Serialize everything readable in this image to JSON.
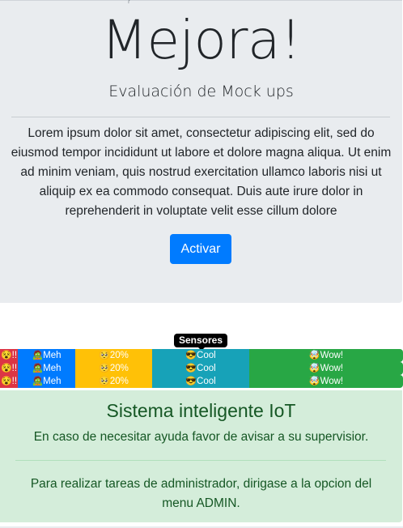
{
  "jumbotron": {
    "mark": "?",
    "title": "Mejora!",
    "subtitle": "Evaluación de Mock ups",
    "paragraph": "Lorem ipsum dolor sit amet, consectetur adipiscing elit, sed do eiusmod tempor incididunt ut labore et dolore magna aliqua. Ut enim ad minim veniam, quis nostrud exercitation ullamco laboris nisi ut aliquip ex ea commodo consequat. Duis aute irure dolor in reprehenderit in voluptate velit esse cillum dolore",
    "button_label": "Activar"
  },
  "tooltip": {
    "label": "Sensores"
  },
  "progress_rows": [
    {
      "segments": [
        {
          "emoji": "😵",
          "text": "!!",
          "color": "#dc3545"
        },
        {
          "emoji": "🧟",
          "text": "Meh",
          "color": "#007bff"
        },
        {
          "emoji": "🥺",
          "text": "20%",
          "color": "#ffc107"
        },
        {
          "emoji": "😎",
          "text": "Cool",
          "color": "#17a2b8"
        },
        {
          "emoji": "🤯",
          "text": "Wow!",
          "color": "#28a745"
        }
      ]
    },
    {
      "segments": [
        {
          "emoji": "😵",
          "text": "!!",
          "color": "#dc3545"
        },
        {
          "emoji": "🧟",
          "text": "Meh",
          "color": "#007bff"
        },
        {
          "emoji": "🥺",
          "text": "20%",
          "color": "#ffc107"
        },
        {
          "emoji": "😎",
          "text": "Cool",
          "color": "#17a2b8"
        },
        {
          "emoji": "🤯",
          "text": "Wow!",
          "color": "#28a745"
        }
      ]
    },
    {
      "segments": [
        {
          "emoji": "😵",
          "text": "!!",
          "color": "#dc3545"
        },
        {
          "emoji": "🧟",
          "text": "Meh",
          "color": "#007bff"
        },
        {
          "emoji": "🥺",
          "text": "20%",
          "color": "#ffc107"
        },
        {
          "emoji": "😎",
          "text": "Cool",
          "color": "#17a2b8"
        },
        {
          "emoji": "🤯",
          "text": "Wow!",
          "color": "#28a745"
        }
      ]
    }
  ],
  "alert": {
    "title": "Sistema inteligente IoT",
    "text1": "En caso de necesitar ayuda favor de avisar a su supervisior.",
    "text2": "Para realizar tareas de administrador, dirigase a la opcion del menu ADMIN."
  },
  "colors": {
    "primary": "#007bff",
    "jumbotron_bg": "#e9ecef",
    "alert_bg": "#d4edda",
    "alert_text": "#155724"
  }
}
